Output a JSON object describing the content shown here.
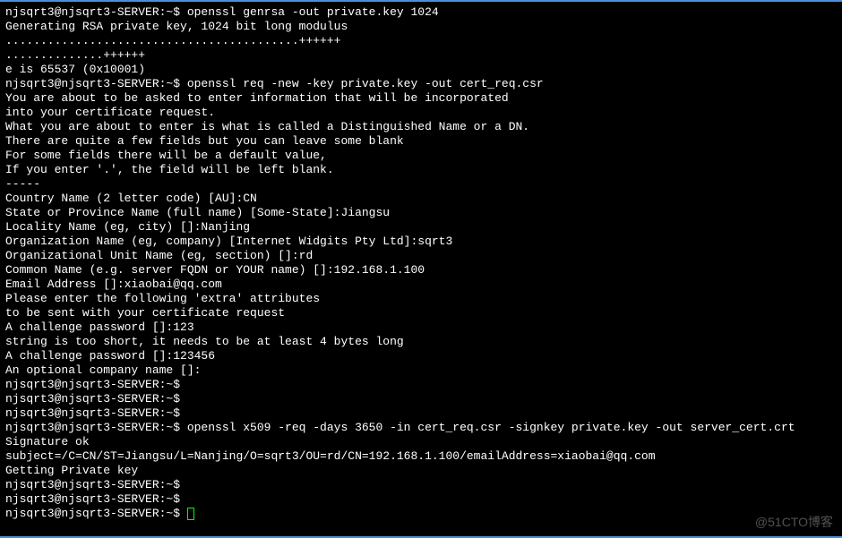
{
  "terminal": {
    "lines": [
      "njsqrt3@njsqrt3-SERVER:~$ openssl genrsa -out private.key 1024",
      "Generating RSA private key, 1024 bit long modulus",
      "..........................................++++++",
      "..............++++++",
      "e is 65537 (0x10001)",
      "njsqrt3@njsqrt3-SERVER:~$ openssl req -new -key private.key -out cert_req.csr",
      "You are about to be asked to enter information that will be incorporated",
      "into your certificate request.",
      "What you are about to enter is what is called a Distinguished Name or a DN.",
      "There are quite a few fields but you can leave some blank",
      "For some fields there will be a default value,",
      "If you enter '.', the field will be left blank.",
      "-----",
      "Country Name (2 letter code) [AU]:CN",
      "State or Province Name (full name) [Some-State]:Jiangsu",
      "Locality Name (eg, city) []:Nanjing",
      "Organization Name (eg, company) [Internet Widgits Pty Ltd]:sqrt3",
      "Organizational Unit Name (eg, section) []:rd",
      "Common Name (e.g. server FQDN or YOUR name) []:192.168.1.100",
      "Email Address []:xiaobai@qq.com",
      "",
      "Please enter the following 'extra' attributes",
      "to be sent with your certificate request",
      "A challenge password []:123",
      "string is too short, it needs to be at least 4 bytes long",
      "A challenge password []:123456",
      "An optional company name []:",
      "njsqrt3@njsqrt3-SERVER:~$",
      "njsqrt3@njsqrt3-SERVER:~$",
      "njsqrt3@njsqrt3-SERVER:~$",
      "njsqrt3@njsqrt3-SERVER:~$ openssl x509 -req -days 3650 -in cert_req.csr -signkey private.key -out server_cert.crt",
      "Signature ok",
      "subject=/C=CN/ST=Jiangsu/L=Nanjing/O=sqrt3/OU=rd/CN=192.168.1.100/emailAddress=xiaobai@qq.com",
      "Getting Private key",
      "njsqrt3@njsqrt3-SERVER:~$",
      "njsqrt3@njsqrt3-SERVER:~$"
    ],
    "final_prompt": "njsqrt3@njsqrt3-SERVER:~$ ",
    "watermark": "@51CTO博客"
  }
}
